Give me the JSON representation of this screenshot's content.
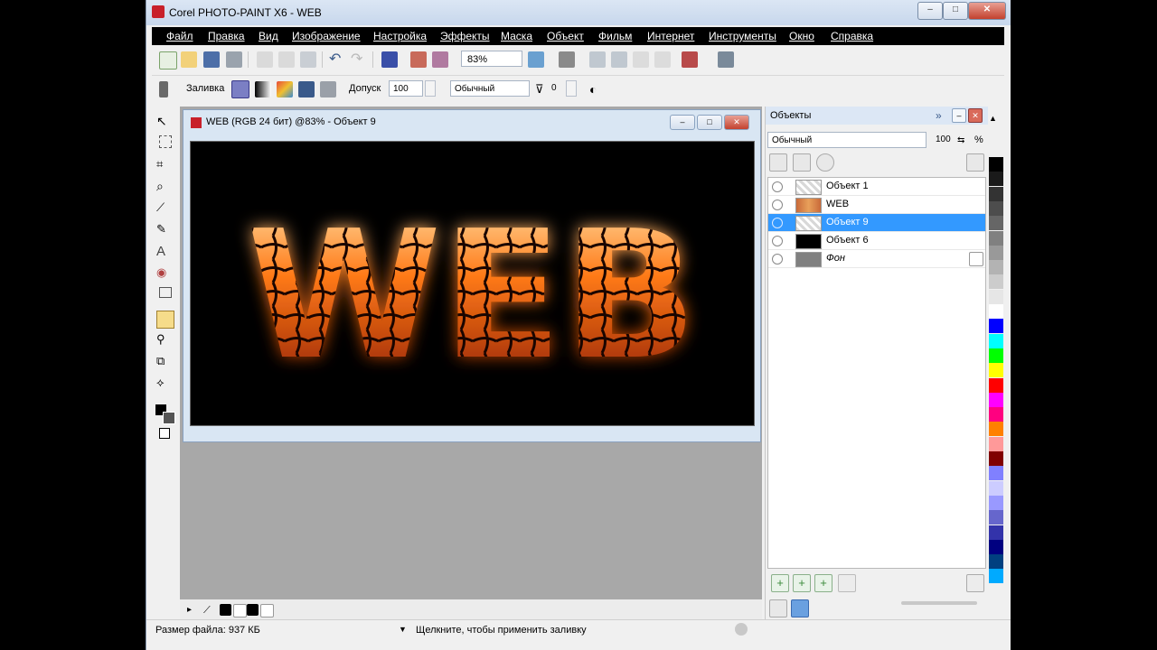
{
  "window": {
    "title": "Corel PHOTO-PAINT X6 - WEB",
    "buttons": [
      "–",
      "□",
      "✕"
    ]
  },
  "menu": [
    "Файл",
    "Правка",
    "Вид",
    "Изображение",
    "Настройка",
    "Эффекты",
    "Маска",
    "Объект",
    "Фильм",
    "Интернет",
    "Инструменты",
    "Окно",
    "Справка"
  ],
  "toolbar": {
    "zoom": "83%"
  },
  "property_bar": {
    "fill_label": "Заливка",
    "tolerance_label": "Допуск",
    "tolerance_value": "100",
    "blend_mode": "Обычный",
    "transparency_value": "0"
  },
  "document": {
    "title": "WEB (RGB 24 бит) @83% - Объект 9",
    "canvas_text": "WEB"
  },
  "objects_panel": {
    "title": "Объекты",
    "blend_mode": "Обычный",
    "opacity": "100",
    "percent": "%",
    "layers": [
      {
        "name": "Объект 1",
        "selected": false
      },
      {
        "name": "WEB",
        "selected": false
      },
      {
        "name": "Объект 9",
        "selected": true
      },
      {
        "name": "Объект 6",
        "selected": false
      },
      {
        "name": "Фон",
        "selected": false
      }
    ]
  },
  "status": {
    "file_size": "Размер файла: 937 КБ",
    "hint": "Щелкните, чтобы применить заливку"
  },
  "palette_colors": [
    "#000000",
    "#1a1a1a",
    "#333333",
    "#4d4d4d",
    "#666666",
    "#808080",
    "#999999",
    "#b3b3b3",
    "#cccccc",
    "#e6e6e6",
    "#ffffff",
    "#0000ff",
    "#00ffff",
    "#00ff00",
    "#ffff00",
    "#ff0000",
    "#ff00ff",
    "#ff0080",
    "#ff8000",
    "#ff9999",
    "#800000",
    "#8080ff",
    "#ccccff",
    "#9999ff",
    "#6666cc",
    "#3333aa",
    "#000080",
    "#004080",
    "#00aaff"
  ],
  "colors": {
    "selection": "#3399ff",
    "menubar": "#000000",
    "workspace": "#a8a8a8"
  }
}
